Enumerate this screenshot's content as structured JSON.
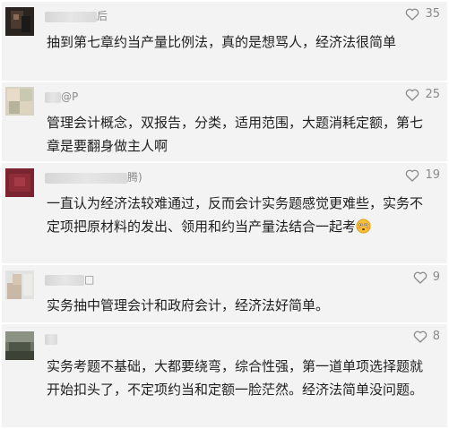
{
  "comments": [
    {
      "name_suffix": "后",
      "likes": "35",
      "text": "抽到第七章约当产量比例法，真的是想骂人，经济法很简单"
    },
    {
      "name_suffix": "@P",
      "likes": "25",
      "text": "管理会计概念，双报告，分类，适用范围，大题消耗定额，第七章是要翻身做主人啊"
    },
    {
      "name_suffix": "腾)",
      "likes": "19",
      "text": "一直认为经济法较难通过，反而会计实务题感觉更难些，实务不定项把原材料的发出、领用和约当产量法结合一起考"
    },
    {
      "name_suffix": "□",
      "likes": "9",
      "text": "实务抽中管理会计和政府会计，经济法好简单。"
    },
    {
      "name_suffix": "",
      "likes": "8",
      "text": "实务考题不基础，大都要绕弯，综合性强，第一道单项选择题就开始扣头了，不定项约当和定额一脸茫然。经济法简单没问题。"
    }
  ],
  "icons": {
    "like": "heart-icon",
    "emoji": "flushed-face-emoji"
  },
  "colors": {
    "card_bg": "#f3f3f3",
    "meta_text": "#8a8a8a",
    "body_text": "#1f1f1f"
  }
}
